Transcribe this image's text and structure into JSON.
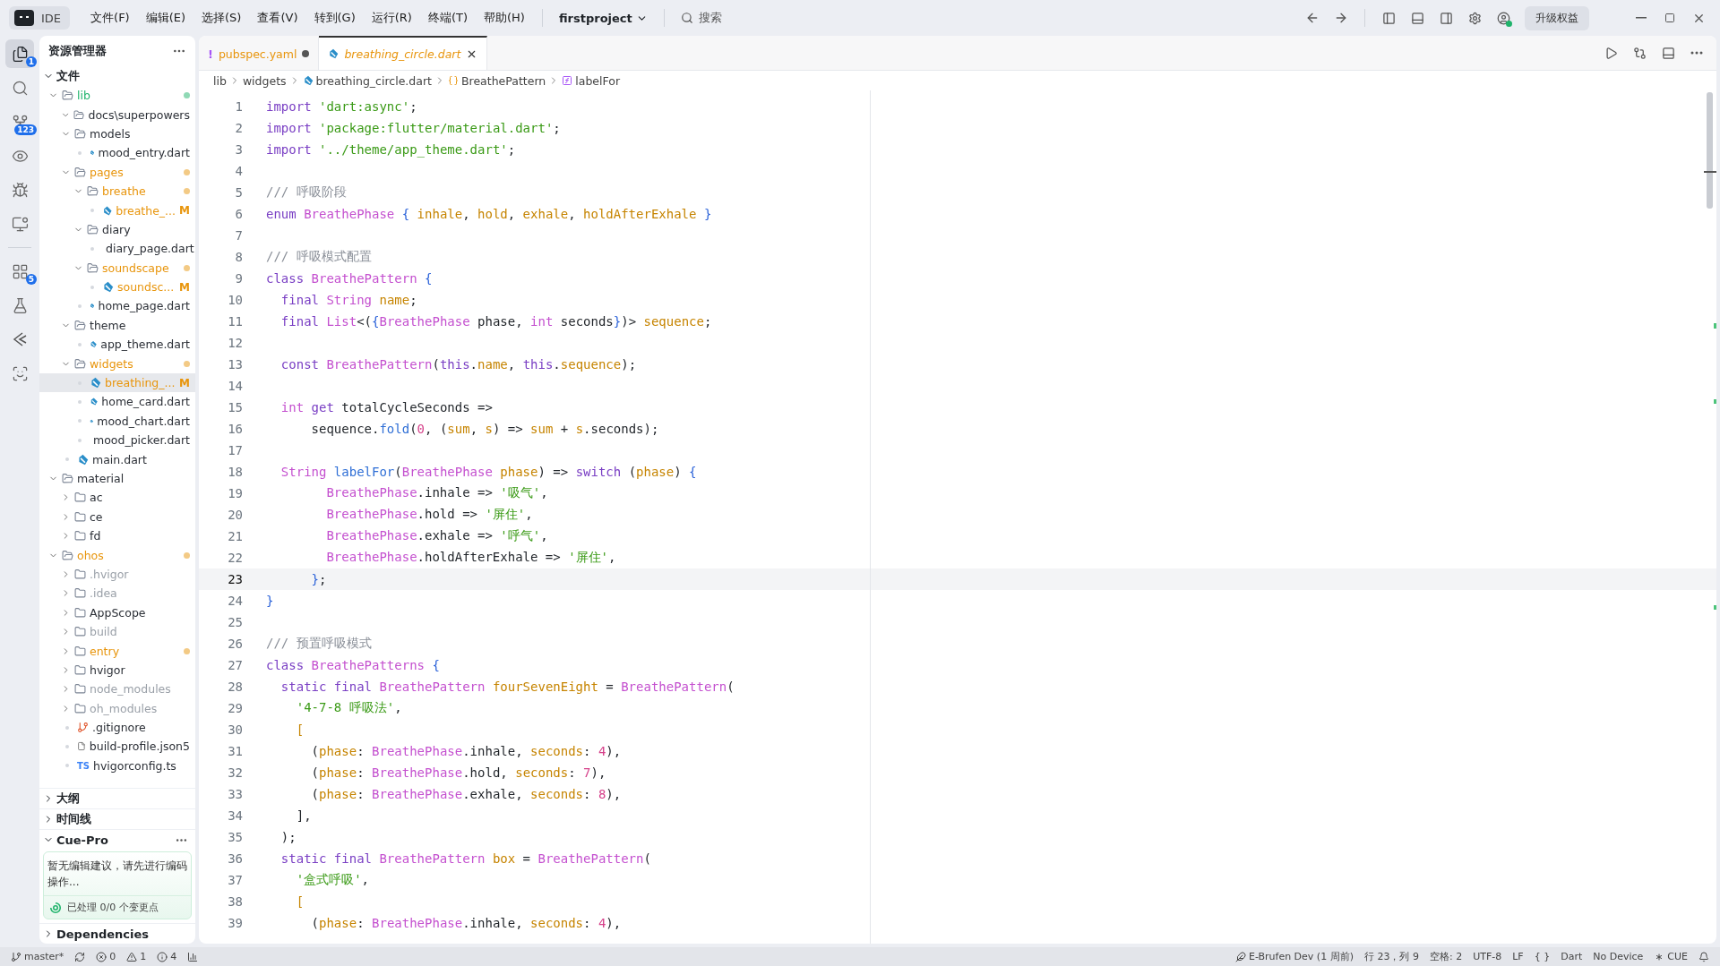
{
  "titlebar": {
    "product": "IDE",
    "menus": [
      "文件(F)",
      "编辑(E)",
      "选择(S)",
      "查看(V)",
      "转到(G)",
      "运行(R)",
      "终端(T)",
      "帮助(H)"
    ],
    "project": "firstproject",
    "search": {
      "placeholder": "搜索"
    },
    "upgrade_button": "升级权益"
  },
  "activity_bar": [
    {
      "kind": "files",
      "badge": "1",
      "selected": true
    },
    {
      "kind": "search",
      "selected": false
    },
    {
      "kind": "source-control",
      "badge": "123",
      "selected": false
    },
    {
      "kind": "eye",
      "selected": false
    },
    {
      "kind": "debug",
      "selected": false
    },
    {
      "kind": "remote",
      "selected": false
    },
    {
      "kind": "divider"
    },
    {
      "kind": "extensions",
      "badge": "5",
      "selected": false
    },
    {
      "kind": "testing",
      "selected": false
    },
    {
      "kind": "flutter",
      "selected": false
    },
    {
      "kind": "scan",
      "selected": false
    }
  ],
  "explorer": {
    "title": "资源管理器",
    "section": {
      "label": "文件",
      "expanded": true
    },
    "tree": [
      {
        "name": "lib",
        "kind": "folder",
        "expanded": true,
        "color": "#1fb36b",
        "dot": true,
        "selected": false,
        "children": [
          {
            "name": "docs\\superpowers",
            "kind": "folder",
            "expanded": true,
            "color": "#2b2f36",
            "dot": false,
            "selected": false
          },
          {
            "name": "models",
            "kind": "folder",
            "expanded": true,
            "color": "#2b2f36",
            "dot": false,
            "selected": false,
            "children": [
              {
                "name": "mood_entry.dart",
                "kind": "dart",
                "color": "#2b2f36",
                "selected": false
              }
            ]
          },
          {
            "name": "pages",
            "kind": "folder",
            "expanded": true,
            "color": "#e8950c",
            "dot": true,
            "selected": false,
            "children": [
              {
                "name": "breathe",
                "kind": "folder",
                "expanded": true,
                "color": "#e8950c",
                "dot": true,
                "selected": false,
                "children": [
                  {
                    "name": "breathe_...",
                    "kind": "dart",
                    "color": "#e8950c",
                    "badge": "M",
                    "selected": false
                  }
                ]
              },
              {
                "name": "diary",
                "kind": "folder",
                "expanded": true,
                "color": "#2b2f36",
                "dot": false,
                "selected": false,
                "children": [
                  {
                    "name": "diary_page.dart",
                    "kind": "dart",
                    "color": "#2b2f36",
                    "selected": false
                  }
                ]
              },
              {
                "name": "soundscape",
                "kind": "folder",
                "expanded": true,
                "color": "#e8950c",
                "dot": true,
                "selected": false,
                "children": [
                  {
                    "name": "soundsc...",
                    "kind": "dart",
                    "color": "#e8950c",
                    "badge": "M",
                    "selected": false
                  }
                ]
              },
              {
                "name": "home_page.dart",
                "kind": "dart",
                "color": "#2b2f36",
                "selected": false
              }
            ]
          },
          {
            "name": "theme",
            "kind": "folder",
            "expanded": true,
            "color": "#2b2f36",
            "dot": false,
            "selected": false,
            "children": [
              {
                "name": "app_theme.dart",
                "kind": "dart",
                "color": "#2b2f36",
                "selected": false
              }
            ]
          },
          {
            "name": "widgets",
            "kind": "folder",
            "expanded": true,
            "color": "#e8950c",
            "dot": true,
            "selected": false,
            "children": [
              {
                "name": "breathing_...",
                "kind": "dart",
                "color": "#e8950c",
                "badge": "M",
                "selected": true
              },
              {
                "name": "home_card.dart",
                "kind": "dart",
                "color": "#2b2f36",
                "selected": false
              },
              {
                "name": "mood_chart.dart",
                "kind": "dart",
                "color": "#2b2f36",
                "selected": false
              },
              {
                "name": "mood_picker.dart",
                "kind": "dart",
                "color": "#2b2f36",
                "selected": false
              }
            ]
          },
          {
            "name": "main.dart",
            "kind": "dart",
            "color": "#2b2f36",
            "selected": false
          }
        ]
      },
      {
        "name": "material",
        "kind": "folder",
        "expanded": true,
        "color": "#2b2f36",
        "dot": false,
        "selected": false,
        "children": [
          {
            "name": "ac",
            "kind": "folder",
            "expanded": false,
            "color": "#2b2f36",
            "dot": false,
            "selected": false
          },
          {
            "name": "ce",
            "kind": "folder",
            "expanded": false,
            "color": "#2b2f36",
            "dot": false,
            "selected": false
          },
          {
            "name": "fd",
            "kind": "folder",
            "expanded": false,
            "color": "#2b2f36",
            "dot": false,
            "selected": false
          }
        ]
      },
      {
        "name": "ohos",
        "kind": "folder",
        "expanded": true,
        "color": "#e8950c",
        "dot": true,
        "selected": false,
        "children": [
          {
            "name": ".hvigor",
            "kind": "folder",
            "expanded": false,
            "color": "#9aa0a8",
            "dot": false,
            "selected": false
          },
          {
            "name": ".idea",
            "kind": "folder",
            "expanded": false,
            "color": "#9aa0a8",
            "dot": false,
            "selected": false
          },
          {
            "name": "AppScope",
            "kind": "folder",
            "expanded": false,
            "color": "#2b2f36",
            "dot": false,
            "selected": false
          },
          {
            "name": "build",
            "kind": "folder",
            "expanded": false,
            "color": "#9aa0a8",
            "dot": false,
            "selected": false
          },
          {
            "name": "entry",
            "kind": "folder",
            "expanded": false,
            "color": "#e8950c",
            "dot": true,
            "selected": false
          },
          {
            "name": "hvigor",
            "kind": "folder",
            "expanded": false,
            "color": "#2b2f36",
            "dot": false,
            "selected": false
          },
          {
            "name": "node_modules",
            "kind": "folder",
            "expanded": false,
            "color": "#9aa0a8",
            "dot": false,
            "selected": false
          },
          {
            "name": "oh_modules",
            "kind": "folder",
            "expanded": false,
            "color": "#9aa0a8",
            "dot": false,
            "selected": false
          },
          {
            "name": ".gitignore",
            "kind": "git",
            "color": "#2b2f36",
            "selected": false
          },
          {
            "name": "build-profile.json5",
            "kind": "file",
            "color": "#2b2f36",
            "selected": false
          },
          {
            "name": "hvigorconfig.ts",
            "kind": "ts",
            "icon_text": "TS",
            "color": "#2b2f36",
            "selected": false
          }
        ]
      }
    ],
    "panels": [
      {
        "label": "大纲",
        "expanded": false
      },
      {
        "label": "时间线",
        "expanded": false
      },
      {
        "label": "Cue-Pro",
        "expanded": true,
        "message": "暂无编辑建议，请先进行编码操作...",
        "status": "已处理 0/0 个变更点"
      },
      {
        "label": "Dependencies",
        "expanded": false
      }
    ]
  },
  "editor": {
    "tabs": [
      {
        "label": "pubspec.yaml",
        "kind": "yaml",
        "icon_text": "!",
        "modified": true,
        "selected": false
      },
      {
        "label": "breathing_circle.dart",
        "kind": "dart",
        "modified": false,
        "selected": true
      }
    ],
    "breadcrumb": [
      {
        "label": "lib",
        "kind": "folder"
      },
      {
        "label": "widgets",
        "kind": "folder"
      },
      {
        "label": "breathing_circle.dart",
        "kind": "dart"
      },
      {
        "label": "BreathePattern",
        "kind": "class"
      },
      {
        "label": "labelFor",
        "kind": "function"
      }
    ],
    "lines": [
      {
        "number": "1",
        "current": false,
        "tokens": [
          {
            "kind": "kw",
            "text": "import "
          },
          {
            "kind": "str",
            "text": "'dart:async'"
          },
          {
            "kind": "plain",
            "text": ";"
          }
        ]
      },
      {
        "number": "2",
        "current": false,
        "tokens": [
          {
            "kind": "kw",
            "text": "import "
          },
          {
            "kind": "str",
            "text": "'package:flutter/material.dart'"
          },
          {
            "kind": "plain",
            "text": ";"
          }
        ]
      },
      {
        "number": "3",
        "current": false,
        "tokens": [
          {
            "kind": "kw",
            "text": "import "
          },
          {
            "kind": "str",
            "text": "'../theme/app_theme.dart'"
          },
          {
            "kind": "plain",
            "text": ";"
          }
        ]
      },
      {
        "number": "4",
        "current": false
      },
      {
        "number": "5",
        "current": false,
        "tokens": [
          {
            "kind": "cmt",
            "text": "/// 呼吸阶段"
          }
        ]
      },
      {
        "number": "6",
        "current": false,
        "tokens": [
          {
            "kind": "kw",
            "text": "enum "
          },
          {
            "kind": "type",
            "text": "BreathePhase "
          },
          {
            "kind": "brace",
            "text": "{ "
          },
          {
            "kind": "field",
            "text": "inhale"
          },
          {
            "kind": "plain",
            "text": ", "
          },
          {
            "kind": "field",
            "text": "hold"
          },
          {
            "kind": "plain",
            "text": ", "
          },
          {
            "kind": "field",
            "text": "exhale"
          },
          {
            "kind": "plain",
            "text": ", "
          },
          {
            "kind": "field",
            "text": "holdAfterExhale "
          },
          {
            "kind": "brace",
            "text": "}"
          }
        ]
      },
      {
        "number": "7",
        "current": false
      },
      {
        "number": "8",
        "current": false,
        "tokens": [
          {
            "kind": "cmt",
            "text": "/// 呼吸模式配置"
          }
        ]
      },
      {
        "number": "9",
        "current": false,
        "tokens": [
          {
            "kind": "kw",
            "text": "class "
          },
          {
            "kind": "type",
            "text": "BreathePattern "
          },
          {
            "kind": "brace",
            "text": "{"
          }
        ]
      },
      {
        "number": "10",
        "current": false,
        "tokens": [
          {
            "kind": "kw",
            "text": "  final "
          },
          {
            "kind": "type",
            "text": "String "
          },
          {
            "kind": "field",
            "text": "name"
          },
          {
            "kind": "plain",
            "text": ";"
          }
        ]
      },
      {
        "number": "11",
        "current": false,
        "tokens": [
          {
            "kind": "kw",
            "text": "  final "
          },
          {
            "kind": "type",
            "text": "List"
          },
          {
            "kind": "plain",
            "text": "<("
          },
          {
            "kind": "brace",
            "text": "{"
          },
          {
            "kind": "type",
            "text": "BreathePhase"
          },
          {
            "kind": "plain",
            "text": " phase, "
          },
          {
            "kind": "type",
            "text": "int"
          },
          {
            "kind": "plain",
            "text": " seconds"
          },
          {
            "kind": "brace",
            "text": "}"
          },
          {
            "kind": "plain",
            "text": ")> "
          },
          {
            "kind": "field",
            "text": "sequence"
          },
          {
            "kind": "plain",
            "text": ";"
          }
        ]
      },
      {
        "number": "12",
        "current": false
      },
      {
        "number": "13",
        "current": false,
        "tokens": [
          {
            "kind": "kw",
            "text": "  const "
          },
          {
            "kind": "type",
            "text": "BreathePattern"
          },
          {
            "kind": "plain",
            "text": "("
          },
          {
            "kind": "kw",
            "text": "this"
          },
          {
            "kind": "plain",
            "text": "."
          },
          {
            "kind": "field",
            "text": "name"
          },
          {
            "kind": "plain",
            "text": ", "
          },
          {
            "kind": "kw",
            "text": "this"
          },
          {
            "kind": "plain",
            "text": "."
          },
          {
            "kind": "field",
            "text": "sequence"
          },
          {
            "kind": "plain",
            "text": ");"
          }
        ]
      },
      {
        "number": "14",
        "current": false
      },
      {
        "number": "15",
        "current": false,
        "tokens": [
          {
            "kind": "type",
            "text": "  int "
          },
          {
            "kind": "kw",
            "text": "get"
          },
          {
            "kind": "plain",
            "text": " totalCycleSeconds =>"
          }
        ]
      },
      {
        "number": "16",
        "current": false,
        "tokens": [
          {
            "kind": "plain",
            "text": "      sequence."
          },
          {
            "kind": "fn",
            "text": "fold"
          },
          {
            "kind": "plain",
            "text": "("
          },
          {
            "kind": "num",
            "text": "0"
          },
          {
            "kind": "plain",
            "text": ", ("
          },
          {
            "kind": "field",
            "text": "sum"
          },
          {
            "kind": "plain",
            "text": ", "
          },
          {
            "kind": "field",
            "text": "s"
          },
          {
            "kind": "plain",
            "text": ") => "
          },
          {
            "kind": "field",
            "text": "sum"
          },
          {
            "kind": "plain",
            "text": " + "
          },
          {
            "kind": "field",
            "text": "s"
          },
          {
            "kind": "plain",
            "text": ".seconds);"
          }
        ]
      },
      {
        "number": "17",
        "current": false
      },
      {
        "number": "18",
        "current": false,
        "tokens": [
          {
            "kind": "type",
            "text": "  String "
          },
          {
            "kind": "fn",
            "text": "labelFor"
          },
          {
            "kind": "plain",
            "text": "("
          },
          {
            "kind": "type",
            "text": "BreathePhase "
          },
          {
            "kind": "field",
            "text": "phase"
          },
          {
            "kind": "plain",
            "text": ") => "
          },
          {
            "kind": "kw",
            "text": "switch"
          },
          {
            "kind": "plain",
            "text": " ("
          },
          {
            "kind": "field",
            "text": "phase"
          },
          {
            "kind": "plain",
            "text": ") "
          },
          {
            "kind": "brace",
            "text": "{"
          }
        ]
      },
      {
        "number": "19",
        "current": false,
        "tokens": [
          {
            "kind": "type",
            "text": "        BreathePhase"
          },
          {
            "kind": "plain",
            "text": ".inhale => "
          },
          {
            "kind": "str",
            "text": "'吸气'"
          },
          {
            "kind": "plain",
            "text": ","
          }
        ]
      },
      {
        "number": "20",
        "current": false,
        "tokens": [
          {
            "kind": "type",
            "text": "        BreathePhase"
          },
          {
            "kind": "plain",
            "text": ".hold => "
          },
          {
            "kind": "str",
            "text": "'屏住'"
          },
          {
            "kind": "plain",
            "text": ","
          }
        ]
      },
      {
        "number": "21",
        "current": false,
        "tokens": [
          {
            "kind": "type",
            "text": "        BreathePhase"
          },
          {
            "kind": "plain",
            "text": ".exhale => "
          },
          {
            "kind": "str",
            "text": "'呼气'"
          },
          {
            "kind": "plain",
            "text": ","
          }
        ]
      },
      {
        "number": "22",
        "current": false,
        "tokens": [
          {
            "kind": "type",
            "text": "        BreathePhase"
          },
          {
            "kind": "plain",
            "text": ".holdAfterExhale => "
          },
          {
            "kind": "str",
            "text": "'屏住'"
          },
          {
            "kind": "plain",
            "text": ","
          }
        ]
      },
      {
        "number": "23",
        "current": true,
        "tokens": [
          {
            "kind": "brace",
            "text": "      }"
          },
          {
            "kind": "plain",
            "text": ";"
          }
        ]
      },
      {
        "number": "24",
        "current": false,
        "tokens": [
          {
            "kind": "brace",
            "text": "}"
          }
        ]
      },
      {
        "number": "25",
        "current": false
      },
      {
        "number": "26",
        "current": false,
        "tokens": [
          {
            "kind": "cmt",
            "text": "/// 预置呼吸模式"
          }
        ]
      },
      {
        "number": "27",
        "current": false,
        "tokens": [
          {
            "kind": "kw",
            "text": "class "
          },
          {
            "kind": "type",
            "text": "BreathePatterns "
          },
          {
            "kind": "brace",
            "text": "{"
          }
        ]
      },
      {
        "number": "28",
        "current": false,
        "tokens": [
          {
            "kind": "kw",
            "text": "  static final "
          },
          {
            "kind": "type",
            "text": "BreathePattern "
          },
          {
            "kind": "field",
            "text": "fourSevenEight"
          },
          {
            "kind": "plain",
            "text": " = "
          },
          {
            "kind": "type",
            "text": "BreathePattern"
          },
          {
            "kind": "plain",
            "text": "("
          }
        ]
      },
      {
        "number": "29",
        "current": false,
        "tokens": [
          {
            "kind": "str",
            "text": "    '4-7-8 呼吸法'"
          },
          {
            "kind": "plain",
            "text": ","
          }
        ]
      },
      {
        "number": "30",
        "current": false,
        "tokens": [
          {
            "kind": "field",
            "text": "    ["
          }
        ]
      },
      {
        "number": "31",
        "current": false,
        "tokens": [
          {
            "kind": "plain",
            "text": "      ("
          },
          {
            "kind": "field",
            "text": "phase"
          },
          {
            "kind": "plain",
            "text": ": "
          },
          {
            "kind": "type",
            "text": "BreathePhase"
          },
          {
            "kind": "plain",
            "text": ".inhale, "
          },
          {
            "kind": "field",
            "text": "seconds"
          },
          {
            "kind": "plain",
            "text": ": "
          },
          {
            "kind": "num",
            "text": "4"
          },
          {
            "kind": "plain",
            "text": "),"
          }
        ]
      },
      {
        "number": "32",
        "current": false,
        "tokens": [
          {
            "kind": "plain",
            "text": "      ("
          },
          {
            "kind": "field",
            "text": "phase"
          },
          {
            "kind": "plain",
            "text": ": "
          },
          {
            "kind": "type",
            "text": "BreathePhase"
          },
          {
            "kind": "plain",
            "text": ".hold, "
          },
          {
            "kind": "field",
            "text": "seconds"
          },
          {
            "kind": "plain",
            "text": ": "
          },
          {
            "kind": "num",
            "text": "7"
          },
          {
            "kind": "plain",
            "text": "),"
          }
        ]
      },
      {
        "number": "33",
        "current": false,
        "tokens": [
          {
            "kind": "plain",
            "text": "      ("
          },
          {
            "kind": "field",
            "text": "phase"
          },
          {
            "kind": "plain",
            "text": ": "
          },
          {
            "kind": "type",
            "text": "BreathePhase"
          },
          {
            "kind": "plain",
            "text": ".exhale, "
          },
          {
            "kind": "field",
            "text": "seconds"
          },
          {
            "kind": "plain",
            "text": ": "
          },
          {
            "kind": "num",
            "text": "8"
          },
          {
            "kind": "plain",
            "text": "),"
          }
        ]
      },
      {
        "number": "34",
        "current": false,
        "tokens": [
          {
            "kind": "plain",
            "text": "    ],"
          }
        ]
      },
      {
        "number": "35",
        "current": false,
        "tokens": [
          {
            "kind": "plain",
            "text": "  );"
          }
        ]
      },
      {
        "number": "36",
        "current": false,
        "tokens": [
          {
            "kind": "kw",
            "text": "  static final "
          },
          {
            "kind": "type",
            "text": "BreathePattern "
          },
          {
            "kind": "field",
            "text": "box"
          },
          {
            "kind": "plain",
            "text": " = "
          },
          {
            "kind": "type",
            "text": "BreathePattern"
          },
          {
            "kind": "plain",
            "text": "("
          }
        ]
      },
      {
        "number": "37",
        "current": false,
        "tokens": [
          {
            "kind": "str",
            "text": "    '盒式呼吸'"
          },
          {
            "kind": "plain",
            "text": ","
          }
        ]
      },
      {
        "number": "38",
        "current": false,
        "tokens": [
          {
            "kind": "field",
            "text": "    ["
          }
        ]
      },
      {
        "number": "39",
        "current": false,
        "tokens": [
          {
            "kind": "plain",
            "text": "      ("
          },
          {
            "kind": "field",
            "text": "phase"
          },
          {
            "kind": "plain",
            "text": ": "
          },
          {
            "kind": "type",
            "text": "BreathePhase"
          },
          {
            "kind": "plain",
            "text": ".inhale, "
          },
          {
            "kind": "field",
            "text": "seconds"
          },
          {
            "kind": "plain",
            "text": ": "
          },
          {
            "kind": "num",
            "text": "4"
          },
          {
            "kind": "plain",
            "text": "),"
          }
        ]
      }
    ]
  },
  "status_bar": {
    "left": [
      {
        "kind": "branch",
        "text": "master*"
      },
      {
        "kind": "sync"
      },
      {
        "kind": "errors",
        "text": "0"
      },
      {
        "kind": "warnings",
        "text": "1"
      },
      {
        "kind": "info",
        "text": "4"
      },
      {
        "kind": "chart"
      }
    ],
    "right": [
      {
        "kind": "account",
        "text": "E-Brufen Dev (1 周前)"
      },
      {
        "kind": "text",
        "text": "行 23，列 9"
      },
      {
        "kind": "text",
        "text": "空格: 2"
      },
      {
        "kind": "text",
        "text": "UTF-8"
      },
      {
        "kind": "text",
        "text": "LF"
      },
      {
        "kind": "text",
        "text": "{ }"
      },
      {
        "kind": "text",
        "text": "Dart"
      },
      {
        "kind": "text",
        "text": "No Device"
      },
      {
        "kind": "cue",
        "text": "CUE"
      },
      {
        "kind": "bell"
      }
    ]
  }
}
